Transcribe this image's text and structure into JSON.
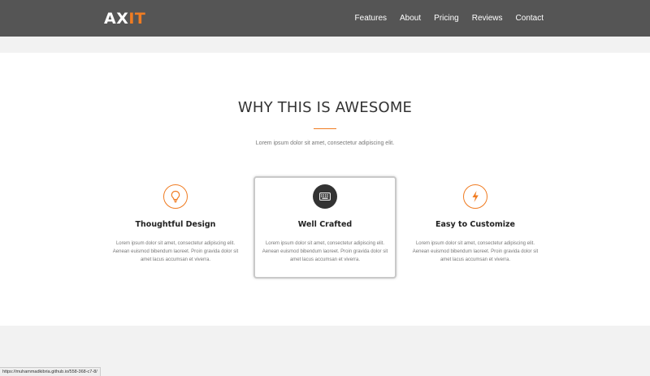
{
  "brand": {
    "logo_part1": "AX",
    "logo_part2": "IT",
    "accent_color": "#f07c22",
    "dark_color": "#333333"
  },
  "nav": {
    "items": [
      {
        "label": "Features"
      },
      {
        "label": "About"
      },
      {
        "label": "Pricing"
      },
      {
        "label": "Reviews"
      },
      {
        "label": "Contact"
      }
    ]
  },
  "section": {
    "heading": "WHY THIS IS AWESOME",
    "subheading": "Lorem ipsum dolor sit amet, consectetur adipiscing elit."
  },
  "features": [
    {
      "icon": "lightbulb-icon",
      "title": "Thoughtful Design",
      "text": "Lorem ipsum dolor sit amet, consectetur adipiscing elit. Aenean euismod bibendum laoreet. Proin gravida dolor sit amet lacus accumsan et viverra."
    },
    {
      "icon": "keyboard-icon",
      "title": "Well Crafted",
      "text": "Lorem ipsum dolor sit amet, consectetur adipiscing elit. Aenean euismod bibendum laoreet. Proin gravida dolor sit amet lacus accumsan et viverra."
    },
    {
      "icon": "lightning-icon",
      "title": "Easy to Customize",
      "text": "Lorem ipsum dolor sit amet, consectetur adipiscing elit. Aenean euismod bibendum laoreet. Proin gravida dolor sit amet lacus accumsan et viverra."
    }
  ],
  "status_bar": {
    "url": "https://muhammadkibria.github.io/558-368-c7-8/"
  }
}
